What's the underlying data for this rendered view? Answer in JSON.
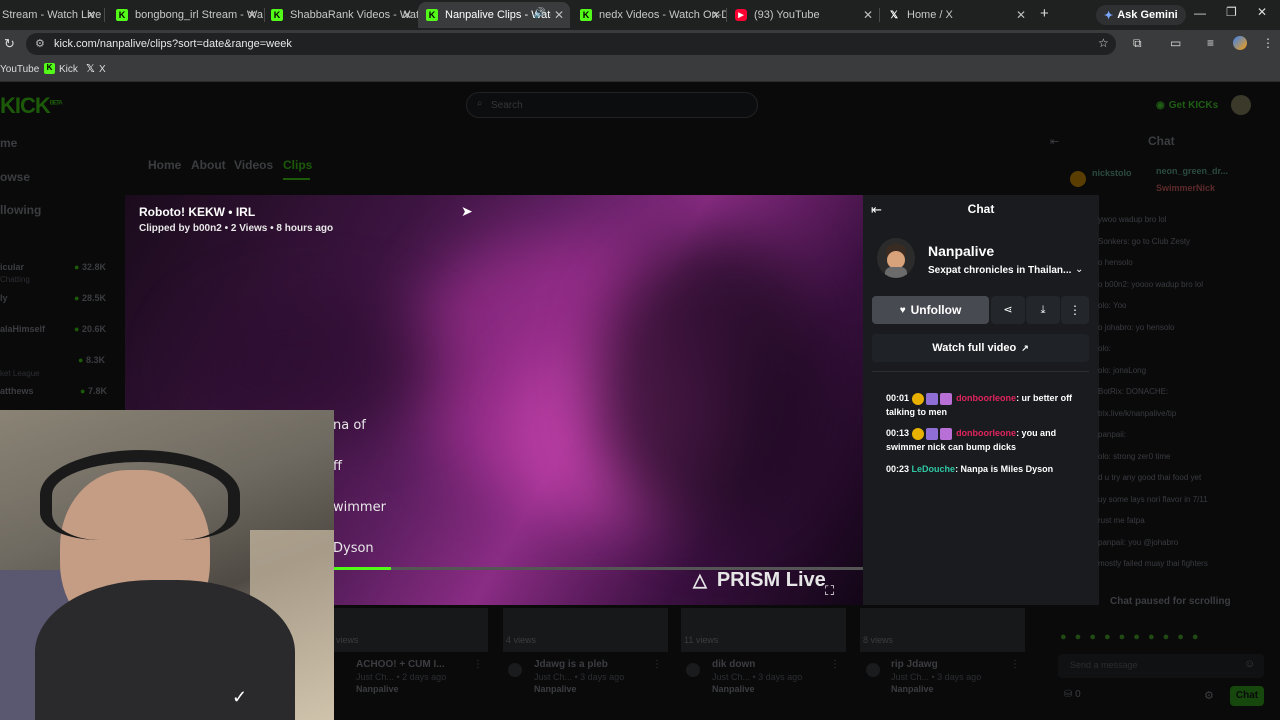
{
  "browser": {
    "tabs": [
      {
        "title": "Stream - Watch Live o",
        "favicon": "kick",
        "active": false
      },
      {
        "title": "bongbong_irl Stream - Watc",
        "favicon": "kick",
        "active": false
      },
      {
        "title": "ShabbaRank Videos - Watch",
        "favicon": "kick",
        "active": false
      },
      {
        "title": "Nanpalive Clips - Watch",
        "favicon": "kick",
        "active": true
      },
      {
        "title": "nedx Videos - Watch On-De",
        "favicon": "kick",
        "active": false
      },
      {
        "title": "(93) YouTube",
        "favicon": "youtube",
        "active": false
      },
      {
        "title": "Home / X",
        "favicon": "x",
        "active": false
      }
    ],
    "ask_gemini": "Ask Gemini",
    "url": "kick.com/nanpalive/clips?sort=date&range=week",
    "bookmarks": [
      "YouTube",
      "Kick",
      "X"
    ]
  },
  "site": {
    "logo": "KICK",
    "logo_tag": "BETA",
    "search_placeholder": "Search",
    "get_kicks": "Get KICKs"
  },
  "sidebar": {
    "nav": [
      "me",
      "owse",
      "llowing"
    ],
    "channels": [
      {
        "name": "icular",
        "sub": "Chatting",
        "viewers": "32.8K"
      },
      {
        "name": "ly",
        "sub": "",
        "viewers": "28.5K"
      },
      {
        "name": "alaHimself",
        "sub": "",
        "viewers": "20.6K"
      },
      {
        "name": "",
        "sub": "ket League",
        "viewers": "8.3K"
      },
      {
        "name": "atthews",
        "sub": "",
        "viewers": "7.8K"
      }
    ]
  },
  "channel_tabs": [
    "Home",
    "About",
    "Videos",
    "Clips"
  ],
  "clip": {
    "title": "Roboto! KEKW • IRL",
    "meta": "Clipped by b00n2 • 2 Views • 8 hours ago",
    "overlay_lines": [
      "na of",
      "ff",
      "wimmer",
      "Dyson"
    ],
    "watermark": "PRISM Live",
    "progress": 0.36
  },
  "clip_panel": {
    "title": "Chat",
    "streamer": "Nanpalive",
    "stream_title": "Sexpat chronicles in Thailan...",
    "unfollow": "Unfollow",
    "watch_full": "Watch full video",
    "messages": [
      {
        "time": "00:01",
        "user": "donboorleone",
        "user_color": "#e0245e",
        "text": ": ur better off talking to men"
      },
      {
        "time": "00:13",
        "user": "donboorleone",
        "user_color": "#e0245e",
        "text": ": you and swimmer nick can bump dicks"
      },
      {
        "time": "00:23",
        "user": "LeDouche",
        "user_color": "#2fc7a4",
        "text": ": Nanpa is Miles Dyson"
      }
    ]
  },
  "right_chat": {
    "title": "Chat",
    "pinned_users": [
      "nickstolo",
      "neon_green_dr...",
      "SwimmerNick"
    ],
    "lines": [
      "ywoo wadup bro lol",
      "Sonkers: go to Club Zesty",
      "o hensolo",
      "o b00n2: yoooo wadup bro lol",
      "olo: Yoo",
      "o johabro: yo hensolo",
      "olo:",
      "olo: jonaLong",
      "BotRix: DONACHE:",
      "trix.live/k/nanpalive/tip",
      "panpaii:",
      "olo: strong zer0 time",
      "d u try any good thai food yet",
      "uy some lays nori flavor in 7/11",
      "rust me fatpa",
      "panpaii: you @johabro",
      "mostly failed muay thai fighters"
    ],
    "paused": "Chat paused for scrolling",
    "input_placeholder": "Send a message",
    "count": "0",
    "send": "Chat"
  },
  "recommended": [
    {
      "views": "views",
      "title": "ACHOO! + CUM I...",
      "sub": "Just Ch... • 2 days ago",
      "channel": "Nanpalive"
    },
    {
      "views": "4 views",
      "title": "Jdawg is a pleb",
      "sub": "Just Ch... • 3 days ago",
      "channel": "Nanpalive"
    },
    {
      "views": "11 views",
      "title": "dik down",
      "sub": "Just Ch... • 3 days ago",
      "channel": "Nanpalive"
    },
    {
      "views": "8 views",
      "title": "rip Jdawg",
      "sub": "Just Ch... • 3 days ago",
      "channel": "Nanpalive"
    }
  ]
}
